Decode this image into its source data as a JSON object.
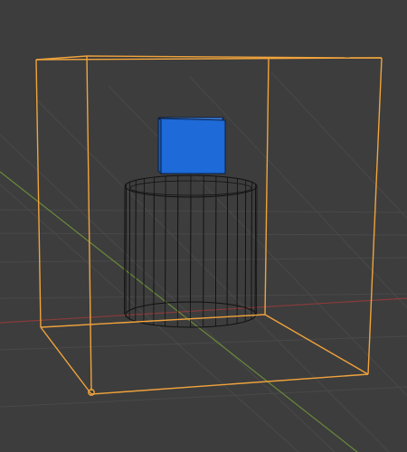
{
  "viewport": {
    "background_color": "#3d3d3d",
    "grid_color": "#494949",
    "x_axis_color": "#8a3b3b",
    "y_axis_color": "#6a8a3a"
  },
  "objects": [
    {
      "name": "bounding-cube",
      "display": "wireframe",
      "selected": true,
      "outline_color": "#f0a33c"
    },
    {
      "name": "cylinder",
      "display": "wireframe",
      "selected": false,
      "wire_color": "#111111"
    },
    {
      "name": "small-cube",
      "display": "solid",
      "selected": false,
      "fill_color": "#1d6ad8"
    }
  ],
  "origin_marker_icon": "origin-dot-icon"
}
